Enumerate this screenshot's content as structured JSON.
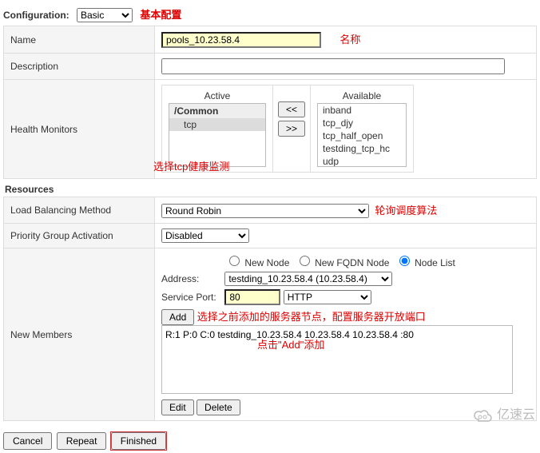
{
  "config": {
    "label": "Configuration:",
    "selected": "Basic",
    "note": "基本配置"
  },
  "name": {
    "label": "Name",
    "value": "pools_10.23.58.4",
    "note": "名称"
  },
  "desc": {
    "label": "Description",
    "value": ""
  },
  "hm": {
    "label": "Health Monitors",
    "active_title": "Active",
    "avail_title": "Available",
    "group": "/Common",
    "active_items": [
      "tcp"
    ],
    "avail_items": [
      "inband",
      "tcp_djy",
      "tcp_half_open",
      "testding_tcp_hc",
      "udp"
    ],
    "btn_left": "<<",
    "btn_right": ">>",
    "note": "选择tcp健康监测"
  },
  "res": {
    "title": "Resources",
    "lb": {
      "label": "Load Balancing Method",
      "value": "Round Robin",
      "note": "轮询调度算法"
    },
    "pga": {
      "label": "Priority Group Activation",
      "value": "Disabled"
    },
    "nm": {
      "label": "New Members",
      "r_new": "New Node",
      "r_fqdn": "New FQDN Node",
      "r_list": "Node List",
      "addr_label": "Address:",
      "addr_value": "testding_10.23.58.4 (10.23.58.4)",
      "port_label": "Service Port:",
      "port_value": "80",
      "port_sel": "HTTP",
      "add": "Add",
      "note1": "选择之前添加的服务器节点，配置服务器开放端口",
      "list_text": "R:1 P:0 C:0 testding_10.23.58.4 10.23.58.4 10.23.58.4 :80",
      "note2": "点击\"Add\"添加",
      "edit": "Edit",
      "del": "Delete"
    }
  },
  "footer": {
    "cancel": "Cancel",
    "repeat": "Repeat",
    "finished": "Finished"
  },
  "wm": "亿速云"
}
